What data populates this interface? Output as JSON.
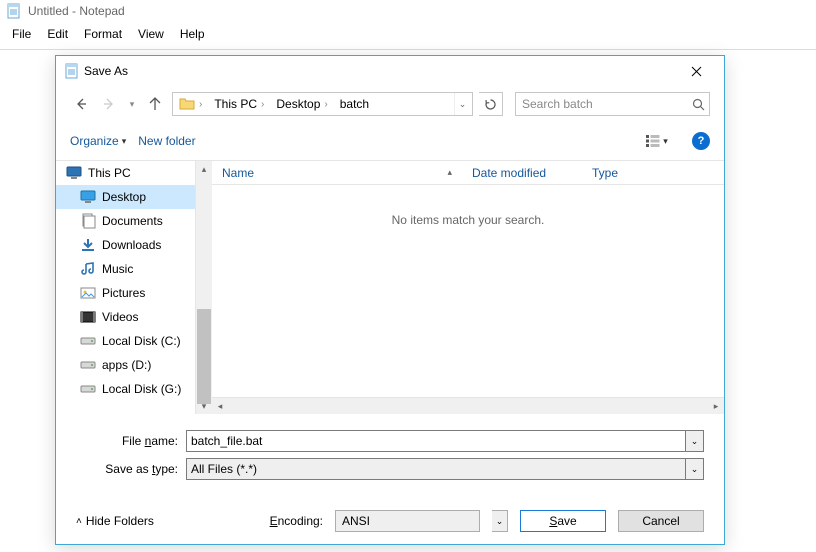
{
  "app": {
    "title": "Untitled - Notepad"
  },
  "menubar": {
    "file": "File",
    "edit": "Edit",
    "format": "Format",
    "view": "View",
    "help": "Help"
  },
  "dialog": {
    "title": "Save As",
    "breadcrumb": {
      "thispc": "This PC",
      "desktop": "Desktop",
      "folder": "batch"
    },
    "search": {
      "placeholder": "Search batch"
    },
    "toolbar": {
      "organize": "Organize",
      "newfolder": "New folder"
    },
    "columns": {
      "name": "Name",
      "date": "Date modified",
      "type": "Type"
    },
    "empty_msg": "No items match your search.",
    "tree": {
      "thispc": "This PC",
      "desktop": "Desktop",
      "documents": "Documents",
      "downloads": "Downloads",
      "music": "Music",
      "pictures": "Pictures",
      "videos": "Videos",
      "diskC": "Local Disk (C:)",
      "diskD": "apps (D:)",
      "diskG": "Local Disk (G:)"
    },
    "form": {
      "filename_label": "File name:",
      "filename_value": "batch_file.bat",
      "type_label": "Save as type:",
      "type_value": "All Files  (*.*)",
      "hide": "Hide Folders",
      "encoding_label": "Encoding:",
      "encoding_value": "ANSI",
      "save": "Save",
      "cancel": "Cancel"
    }
  }
}
